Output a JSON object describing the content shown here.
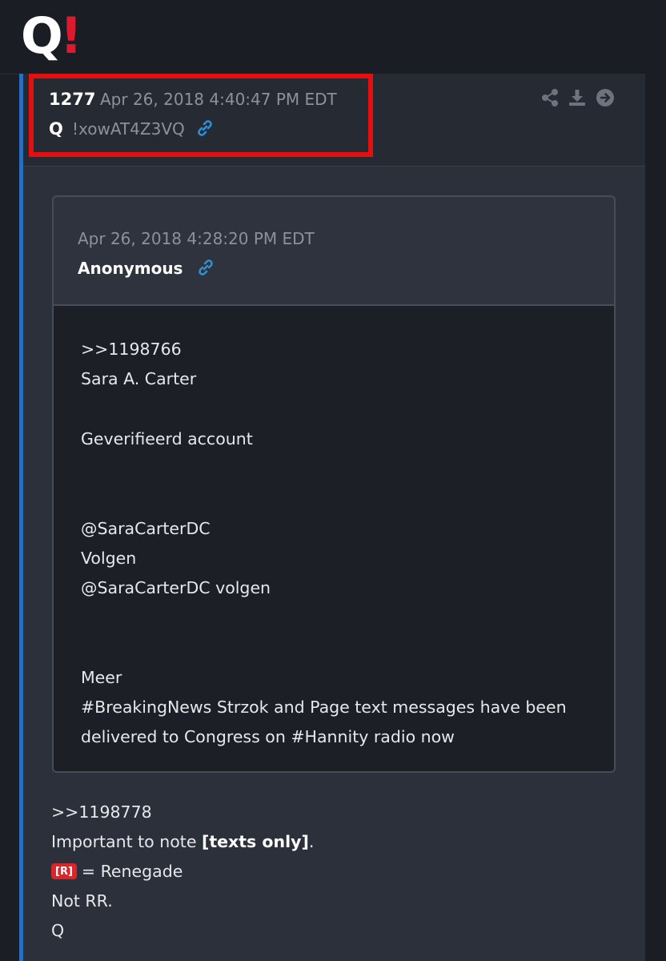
{
  "header": {
    "logo_letter": "Q",
    "logo_mark": "!",
    "logo_color": "#e0182d"
  },
  "post": {
    "number": "1277",
    "timestamp": "Apr 26, 2018 4:40:47 PM EDT",
    "author": "Q",
    "tripcode": "!xowAT4Z3VQ",
    "highlight_color": "#e40f0f",
    "actions": [
      {
        "name": "share",
        "icon": "share-icon"
      },
      {
        "name": "download",
        "icon": "download-icon"
      },
      {
        "name": "goto",
        "icon": "arrow-right-circle-icon"
      }
    ]
  },
  "quote": {
    "timestamp": "Apr 26, 2018 4:28:20 PM EDT",
    "author": "Anonymous",
    "lines": [
      ">>1198766",
      "Sara A. Carter",
      "Geverifieerd account",
      "@SaraCarterDC",
      "Volgen",
      "@SaraCarterDC volgen",
      "Meer",
      "#BreakingNews Strzok and Page text messages have been",
      "delivered to Congress on #Hannity radio now"
    ]
  },
  "reply": {
    "ref": ">>1198778",
    "note_prefix": "Important to note ",
    "note_bold": "[texts only]",
    "note_suffix": ".",
    "badge": "[R]",
    "badge_text": "= Renegade",
    "line_4": "Not RR.",
    "signature": "Q"
  },
  "colors": {
    "accent_link": "#2f8fd6",
    "rail": "#2a6fbf",
    "badge": "#d8262b"
  }
}
